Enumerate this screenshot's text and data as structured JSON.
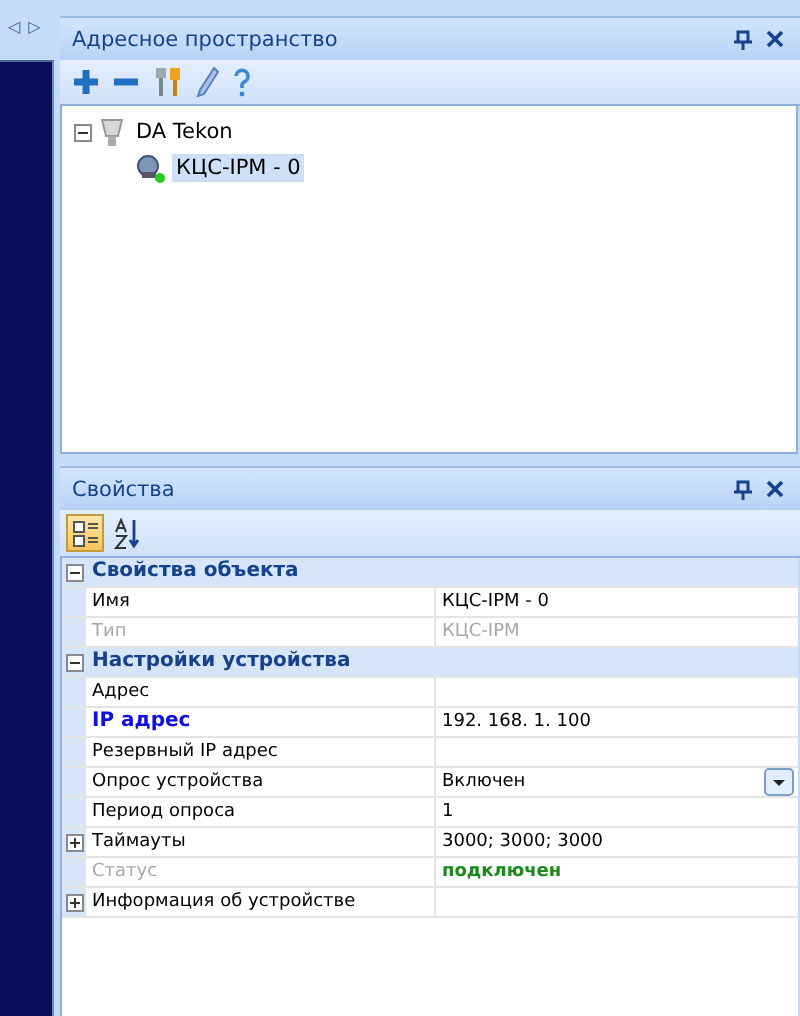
{
  "side_panel": {
    "arrows": [
      "◁",
      "▷"
    ]
  },
  "address_space": {
    "title": "Адресное пространство",
    "toolbar": [
      {
        "kind": "add"
      },
      {
        "kind": "remove"
      },
      {
        "kind": "tools"
      },
      {
        "kind": "edit"
      },
      {
        "kind": "help"
      }
    ],
    "tree": [
      {
        "label": "DA Tekon",
        "expanded": true,
        "selected": false,
        "children": [
          {
            "label": "КЦС-IPM - 0",
            "selected": true
          }
        ]
      }
    ]
  },
  "properties": {
    "title": "Свойства",
    "toolbar": [
      {
        "kind": "categorized",
        "selected": true
      },
      {
        "kind": "alphabetical",
        "selected": false
      }
    ],
    "categories": [
      {
        "label": "Свойства объекта",
        "expanded": true,
        "rows": [
          {
            "kind": "text",
            "name": "Имя",
            "value": "КЦС-IPM - 0",
            "disabled": false,
            "selected": false
          },
          {
            "kind": "text",
            "name": "Тип",
            "value": "КЦС-IPM",
            "disabled": true,
            "selected": false
          }
        ]
      },
      {
        "label": "Настройки устройства",
        "expanded": true,
        "rows": [
          {
            "kind": "text",
            "name": "Адрес",
            "disabled": false,
            "selected": false
          },
          {
            "kind": "text",
            "name": "IP адрес",
            "value": "192. 168. 1. 100",
            "disabled": false,
            "selected": true
          },
          {
            "kind": "text",
            "name": "Резервный IP адрес",
            "disabled": false,
            "selected": false
          },
          {
            "kind": "dropdown",
            "name": "Опрос устройства",
            "value": "Включен",
            "disabled": false,
            "selected": false
          },
          {
            "kind": "text",
            "name": "Период опроса",
            "value": "1",
            "disabled": false,
            "selected": false
          },
          {
            "kind": "expandable",
            "name": "Таймауты",
            "value": "3000; 3000; 3000",
            "expanded": false,
            "disabled": false,
            "selected": false
          },
          {
            "kind": "status",
            "name": "Статус",
            "value": "подключен",
            "disabled": true,
            "selected": false
          },
          {
            "kind": "expandable",
            "name": "Информация об устройстве",
            "expanded": false,
            "disabled": false,
            "selected": false
          }
        ]
      }
    ]
  }
}
